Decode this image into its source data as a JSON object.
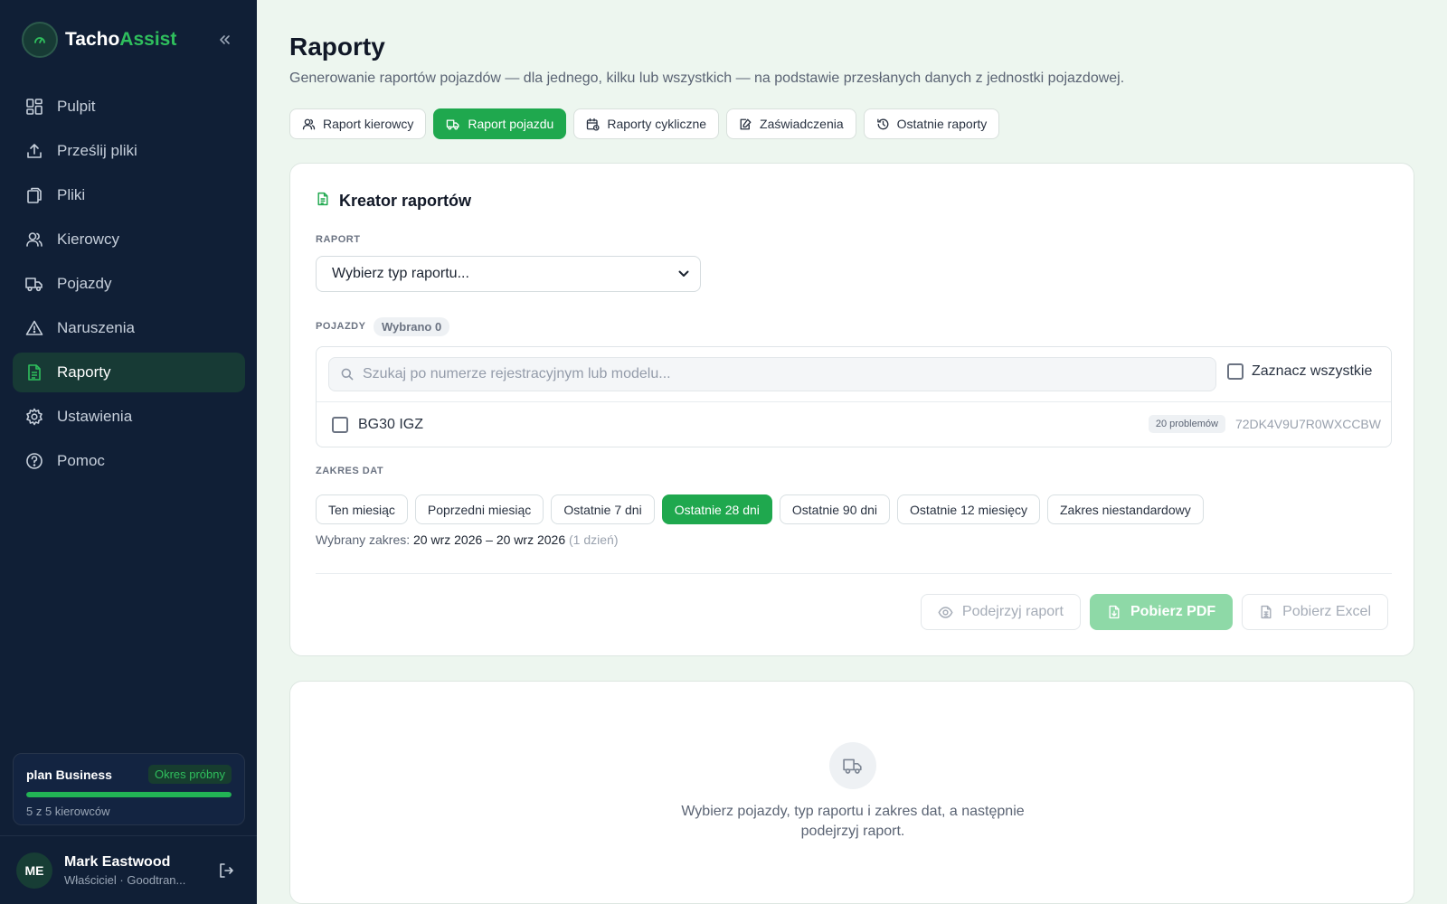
{
  "brand": {
    "name_main": "Tacho",
    "name_accent": "Assist"
  },
  "sidebar": {
    "items": [
      {
        "label": "Pulpit",
        "icon": "dashboard-icon"
      },
      {
        "label": "Prześlij pliki",
        "icon": "upload-icon"
      },
      {
        "label": "Pliki",
        "icon": "files-icon"
      },
      {
        "label": "Kierowcy",
        "icon": "users-icon"
      },
      {
        "label": "Pojazdy",
        "icon": "truck-icon"
      },
      {
        "label": "Naruszenia",
        "icon": "warning-icon"
      },
      {
        "label": "Raporty",
        "icon": "report-icon",
        "active": true
      },
      {
        "label": "Ustawienia",
        "icon": "gear-icon"
      },
      {
        "label": "Pomoc",
        "icon": "help-icon"
      }
    ],
    "plan": {
      "name": "plan Business",
      "badge": "Okres próbny",
      "usage": "5 z 5 kierowców",
      "progress": 1.0
    },
    "user": {
      "initials": "ME",
      "name": "Mark Eastwood",
      "role": "Właściciel · Goodtran..."
    }
  },
  "page": {
    "title": "Raporty",
    "subtitle": "Generowanie raportów pojazdów — dla jednego, kilku lub wszystkich — na podstawie przesłanych danych z jednostki pojazdowej.",
    "tabs": [
      {
        "label": "Raport kierowcy",
        "icon": "users-icon"
      },
      {
        "label": "Raport pojazdu",
        "icon": "truck-icon",
        "active": true
      },
      {
        "label": "Raporty cykliczne",
        "icon": "calendar-clock-icon"
      },
      {
        "label": "Zaświadczenia",
        "icon": "edit-document-icon"
      },
      {
        "label": "Ostatnie raporty",
        "icon": "history-icon"
      }
    ]
  },
  "creator": {
    "title": "Kreator raportów",
    "report_label": "RAPORT",
    "report_select": "Wybierz typ raportu...",
    "vehicles_label": "POJAZDY",
    "selected_badge": "Wybrano 0",
    "search_placeholder": "Szukaj po numerze rejestracyjnym lub modelu...",
    "select_all": "Zaznacz wszystkie",
    "vehicles": [
      {
        "plate": "BG30 IGZ",
        "issues": "20 problemów",
        "vin": "72DK4V9U7R0WXCCBW"
      }
    ],
    "date_label": "ZAKRES DAT",
    "ranges": [
      {
        "label": "Ten miesiąc"
      },
      {
        "label": "Poprzedni miesiąc"
      },
      {
        "label": "Ostatnie 7 dni"
      },
      {
        "label": "Ostatnie 28 dni",
        "active": true
      },
      {
        "label": "Ostatnie 90 dni"
      },
      {
        "label": "Ostatnie 12 miesięcy"
      },
      {
        "label": "Zakres niestandardowy"
      }
    ],
    "range_prefix": "Wybrany zakres:",
    "range_value": "20 wrz 2026 – 20 wrz 2026",
    "range_days": "(1 dzień)",
    "actions": {
      "preview": "Podejrzyj raport",
      "pdf": "Pobierz PDF",
      "excel": "Pobierz Excel"
    }
  },
  "empty_state": {
    "text": "Wybierz pojazdy, typ raportu i zakres dat, a następnie podejrzyj raport."
  },
  "colors": {
    "sidebar_bg": "#101f36",
    "accent": "#1fa84e",
    "page_bg": "#edf6ef"
  }
}
